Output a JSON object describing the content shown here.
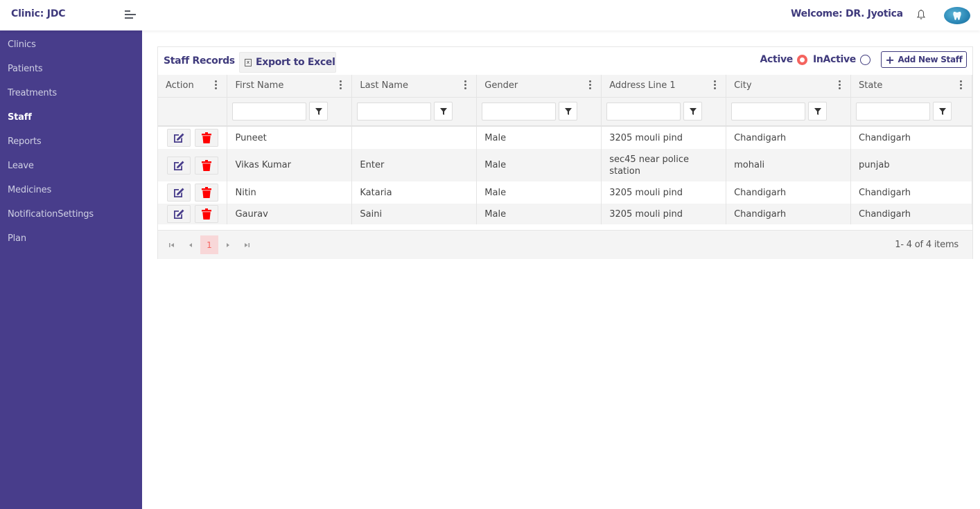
{
  "topbar": {
    "brand": "Clinic: JDC",
    "welcome": "Welcome: DR. Jyotica"
  },
  "sidebar": {
    "items": [
      {
        "label": "Clinics",
        "active": false
      },
      {
        "label": "Patients",
        "active": false
      },
      {
        "label": "Treatments",
        "active": false
      },
      {
        "label": "Staff",
        "active": true
      },
      {
        "label": "Reports",
        "active": false
      },
      {
        "label": "Leave",
        "active": false
      },
      {
        "label": "Medicines",
        "active": false
      },
      {
        "label": "NotificationSettings",
        "active": false
      },
      {
        "label": "Plan",
        "active": false
      }
    ]
  },
  "card": {
    "title": "Staff Records",
    "export_label": "Export to Excel",
    "export_icon_glyph": "x",
    "active_label": "Active",
    "inactive_label": "InActive",
    "selected_filter": "Active",
    "add_label": "Add New Staff",
    "add_icon": "+"
  },
  "grid": {
    "columns": [
      "Action",
      "First Name",
      "Last Name",
      "Gender",
      "Address Line 1",
      "City",
      "State"
    ],
    "rows": [
      {
        "first": "Puneet",
        "last": "",
        "gender": "Male",
        "address": "3205 mouli pind",
        "city": "Chandigarh",
        "state": "Chandigarh"
      },
      {
        "first": "Vikas Kumar",
        "last": "Enter",
        "gender": "Male",
        "address": "sec45 near police station",
        "city": "mohali",
        "state": "punjab"
      },
      {
        "first": "Nitin",
        "last": "Kataria",
        "gender": "Male",
        "address": "3205 mouli pind",
        "city": "Chandigarh",
        "state": "Chandigarh"
      },
      {
        "first": "Gaurav",
        "last": "Saini",
        "gender": "Male",
        "address": "3205 mouli pind",
        "city": "Chandigarh",
        "state": "Chandigarh"
      }
    ]
  },
  "pager": {
    "current_page": "1",
    "info": "1- 4 of 4 items"
  },
  "colors": {
    "sidebar_bg": "#483d8b",
    "brand_text": "#3f3a7c",
    "accent_red": "#f4645f",
    "edit_icon": "#483d8b",
    "delete_icon": "#ff0000"
  }
}
